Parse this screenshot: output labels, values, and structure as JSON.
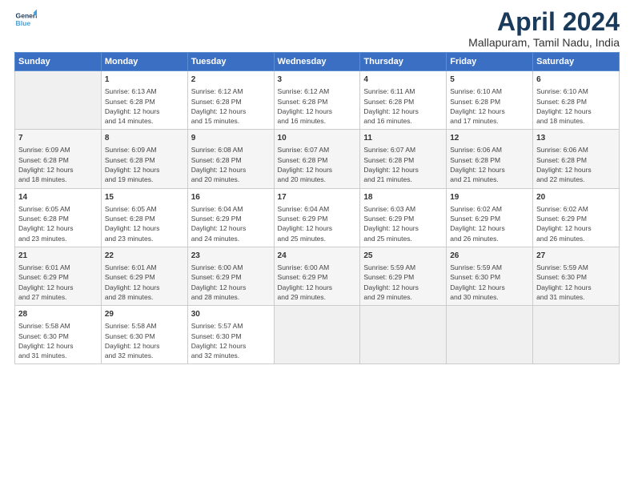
{
  "logo": {
    "line1": "General",
    "line2": "Blue"
  },
  "title": "April 2024",
  "subtitle": "Mallapuram, Tamil Nadu, India",
  "days_of_week": [
    "Sunday",
    "Monday",
    "Tuesday",
    "Wednesday",
    "Thursday",
    "Friday",
    "Saturday"
  ],
  "weeks": [
    [
      {
        "num": "",
        "info": ""
      },
      {
        "num": "1",
        "info": "Sunrise: 6:13 AM\nSunset: 6:28 PM\nDaylight: 12 hours\nand 14 minutes."
      },
      {
        "num": "2",
        "info": "Sunrise: 6:12 AM\nSunset: 6:28 PM\nDaylight: 12 hours\nand 15 minutes."
      },
      {
        "num": "3",
        "info": "Sunrise: 6:12 AM\nSunset: 6:28 PM\nDaylight: 12 hours\nand 16 minutes."
      },
      {
        "num": "4",
        "info": "Sunrise: 6:11 AM\nSunset: 6:28 PM\nDaylight: 12 hours\nand 16 minutes."
      },
      {
        "num": "5",
        "info": "Sunrise: 6:10 AM\nSunset: 6:28 PM\nDaylight: 12 hours\nand 17 minutes."
      },
      {
        "num": "6",
        "info": "Sunrise: 6:10 AM\nSunset: 6:28 PM\nDaylight: 12 hours\nand 18 minutes."
      }
    ],
    [
      {
        "num": "7",
        "info": "Sunrise: 6:09 AM\nSunset: 6:28 PM\nDaylight: 12 hours\nand 18 minutes."
      },
      {
        "num": "8",
        "info": "Sunrise: 6:09 AM\nSunset: 6:28 PM\nDaylight: 12 hours\nand 19 minutes."
      },
      {
        "num": "9",
        "info": "Sunrise: 6:08 AM\nSunset: 6:28 PM\nDaylight: 12 hours\nand 20 minutes."
      },
      {
        "num": "10",
        "info": "Sunrise: 6:07 AM\nSunset: 6:28 PM\nDaylight: 12 hours\nand 20 minutes."
      },
      {
        "num": "11",
        "info": "Sunrise: 6:07 AM\nSunset: 6:28 PM\nDaylight: 12 hours\nand 21 minutes."
      },
      {
        "num": "12",
        "info": "Sunrise: 6:06 AM\nSunset: 6:28 PM\nDaylight: 12 hours\nand 21 minutes."
      },
      {
        "num": "13",
        "info": "Sunrise: 6:06 AM\nSunset: 6:28 PM\nDaylight: 12 hours\nand 22 minutes."
      }
    ],
    [
      {
        "num": "14",
        "info": "Sunrise: 6:05 AM\nSunset: 6:28 PM\nDaylight: 12 hours\nand 23 minutes."
      },
      {
        "num": "15",
        "info": "Sunrise: 6:05 AM\nSunset: 6:28 PM\nDaylight: 12 hours\nand 23 minutes."
      },
      {
        "num": "16",
        "info": "Sunrise: 6:04 AM\nSunset: 6:29 PM\nDaylight: 12 hours\nand 24 minutes."
      },
      {
        "num": "17",
        "info": "Sunrise: 6:04 AM\nSunset: 6:29 PM\nDaylight: 12 hours\nand 25 minutes."
      },
      {
        "num": "18",
        "info": "Sunrise: 6:03 AM\nSunset: 6:29 PM\nDaylight: 12 hours\nand 25 minutes."
      },
      {
        "num": "19",
        "info": "Sunrise: 6:02 AM\nSunset: 6:29 PM\nDaylight: 12 hours\nand 26 minutes."
      },
      {
        "num": "20",
        "info": "Sunrise: 6:02 AM\nSunset: 6:29 PM\nDaylight: 12 hours\nand 26 minutes."
      }
    ],
    [
      {
        "num": "21",
        "info": "Sunrise: 6:01 AM\nSunset: 6:29 PM\nDaylight: 12 hours\nand 27 minutes."
      },
      {
        "num": "22",
        "info": "Sunrise: 6:01 AM\nSunset: 6:29 PM\nDaylight: 12 hours\nand 28 minutes."
      },
      {
        "num": "23",
        "info": "Sunrise: 6:00 AM\nSunset: 6:29 PM\nDaylight: 12 hours\nand 28 minutes."
      },
      {
        "num": "24",
        "info": "Sunrise: 6:00 AM\nSunset: 6:29 PM\nDaylight: 12 hours\nand 29 minutes."
      },
      {
        "num": "25",
        "info": "Sunrise: 5:59 AM\nSunset: 6:29 PM\nDaylight: 12 hours\nand 29 minutes."
      },
      {
        "num": "26",
        "info": "Sunrise: 5:59 AM\nSunset: 6:30 PM\nDaylight: 12 hours\nand 30 minutes."
      },
      {
        "num": "27",
        "info": "Sunrise: 5:59 AM\nSunset: 6:30 PM\nDaylight: 12 hours\nand 31 minutes."
      }
    ],
    [
      {
        "num": "28",
        "info": "Sunrise: 5:58 AM\nSunset: 6:30 PM\nDaylight: 12 hours\nand 31 minutes."
      },
      {
        "num": "29",
        "info": "Sunrise: 5:58 AM\nSunset: 6:30 PM\nDaylight: 12 hours\nand 32 minutes."
      },
      {
        "num": "30",
        "info": "Sunrise: 5:57 AM\nSunset: 6:30 PM\nDaylight: 12 hours\nand 32 minutes."
      },
      {
        "num": "",
        "info": ""
      },
      {
        "num": "",
        "info": ""
      },
      {
        "num": "",
        "info": ""
      },
      {
        "num": "",
        "info": ""
      }
    ]
  ]
}
